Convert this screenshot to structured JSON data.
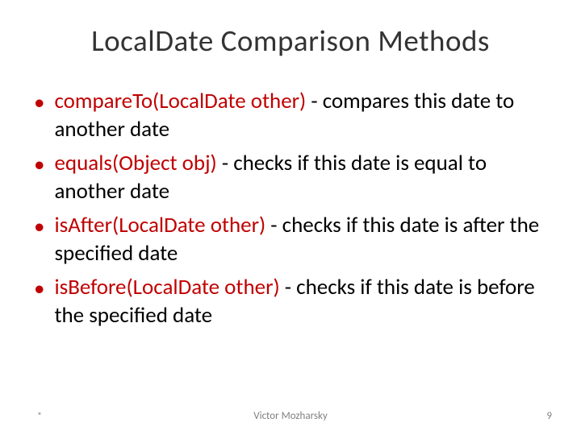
{
  "title": "LocalDate Comparison Methods",
  "bullets": [
    {
      "method": "compareTo(LocalDate other)",
      "description": " - compares this date to another date"
    },
    {
      "method": "equals(Object obj)",
      "description": " - checks if this date is equal to another date"
    },
    {
      "method": "isAfter(LocalDate other)",
      "description": " - checks if this date is after the specified date"
    },
    {
      "method": "isBefore(LocalDate other)",
      "description": " - checks if this date is before the specified date"
    }
  ],
  "footer": {
    "asterisk": "*",
    "author": "Victor Mozharsky",
    "page": "9"
  }
}
